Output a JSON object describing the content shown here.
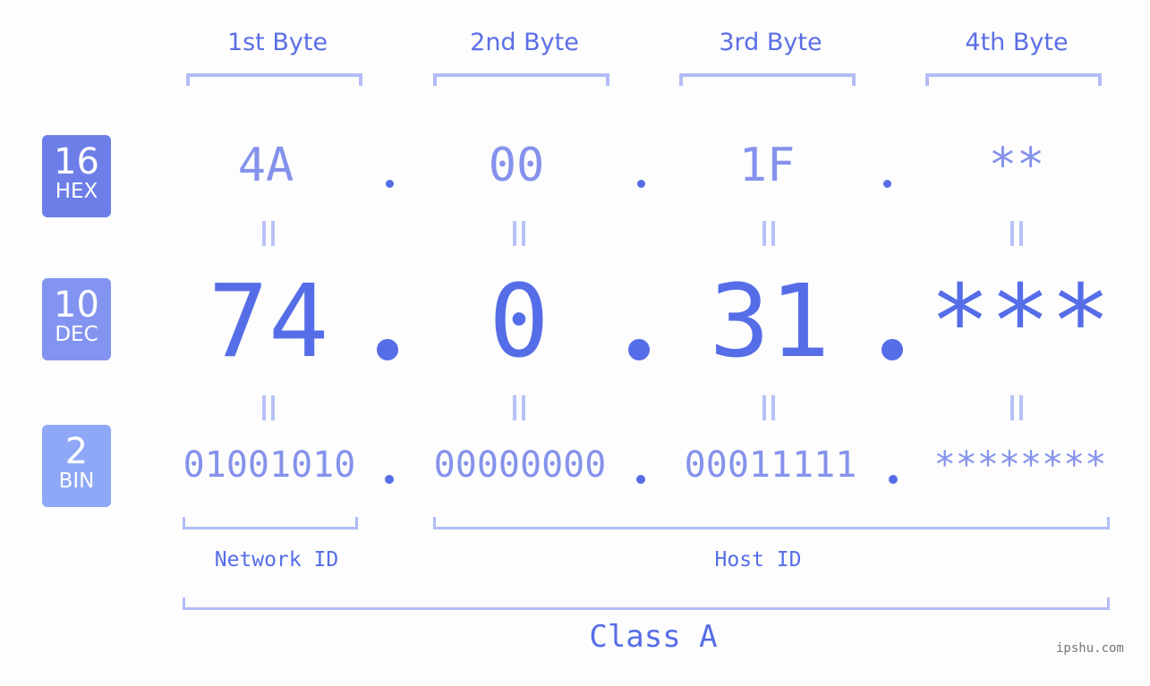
{
  "byte_headers": [
    "1st Byte",
    "2nd Byte",
    "3rd Byte",
    "4th Byte"
  ],
  "badges": [
    {
      "num": "16",
      "label": "HEX",
      "color": "#6d7ee8"
    },
    {
      "num": "10",
      "label": "DEC",
      "color": "#8394f0"
    },
    {
      "num": "2",
      "label": "BIN",
      "color": "#8ea7f6"
    }
  ],
  "hex": [
    "4A",
    "00",
    "1F",
    "**"
  ],
  "dec": [
    "74",
    "0",
    "31",
    "***"
  ],
  "bin": [
    "01001010",
    "00000000",
    "00011111",
    "********"
  ],
  "network_label": "Network ID",
  "host_label": "Host ID",
  "class_label": "Class A",
  "watermark": "ipshu.com",
  "colors": {
    "accent": "#566de8",
    "light": "#8592ec",
    "bracket": "#b3bcf6"
  }
}
